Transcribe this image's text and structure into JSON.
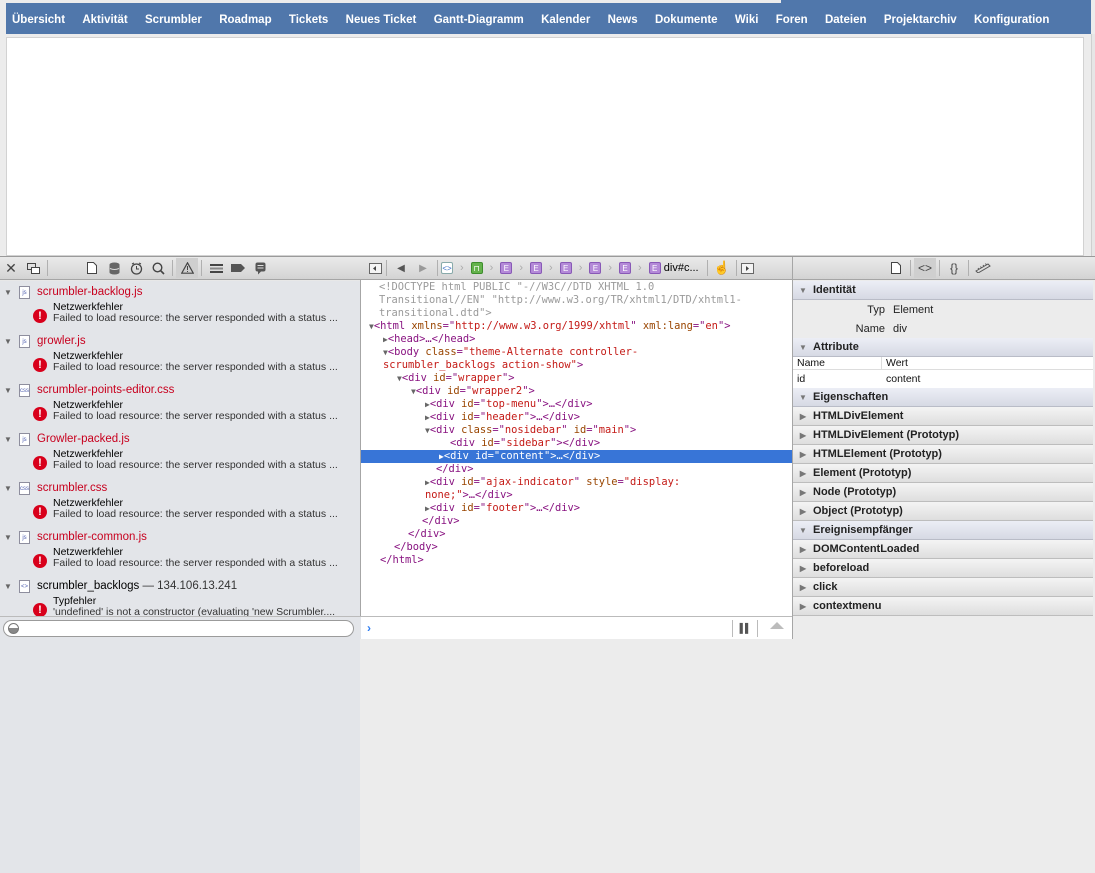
{
  "page": {
    "menu": [
      "Übersicht",
      "Aktivität",
      "Scrumbler",
      "Roadmap",
      "Tickets",
      "Neues Ticket",
      "Gantt-Diagramm",
      "Kalender",
      "News",
      "Dokumente",
      "Wiki",
      "Foren",
      "Dateien",
      "Projektarchiv",
      "Konfiguration"
    ],
    "brand_color": "#5077ab"
  },
  "console": {
    "toolbar_icons": [
      "close-icon",
      "undock-icon",
      "resources-icon",
      "storage-icon",
      "timeline-icon",
      "search-icon",
      "issues-icon",
      "log-icon",
      "breakpoints-icon",
      "console-icon"
    ],
    "groups": [
      {
        "file": "scrumbler-backlog.js",
        "type": "js",
        "title": "Netzwerkfehler",
        "message": "Failed to load resource: the server responded with a status ..."
      },
      {
        "file": "growler.js",
        "type": "js",
        "title": "Netzwerkfehler",
        "message": "Failed to load resource: the server responded with a status ..."
      },
      {
        "file": "scrumbler-points-editor.css",
        "type": "css",
        "title": "Netzwerkfehler",
        "message": "Failed to load resource: the server responded with a status ..."
      },
      {
        "file": "Growler-packed.js",
        "type": "js",
        "title": "Netzwerkfehler",
        "message": "Failed to load resource: the server responded with a status ..."
      },
      {
        "file": "scrumbler.css",
        "type": "css",
        "title": "Netzwerkfehler",
        "message": "Failed to load resource: the server responded with a status ..."
      },
      {
        "file": "scrumbler-common.js",
        "type": "js",
        "title": "Netzwerkfehler",
        "message": "Failed to load resource: the server responded with a status ..."
      },
      {
        "file": "scrumbler_backlogs",
        "type": "html",
        "host": " — 134.106.13.241",
        "title": "Typfehler",
        "message": "'undefined' is not a constructor (evaluating 'new Scrumbler...."
      }
    ],
    "filter_value": ""
  },
  "dom": {
    "breadcrumb_last": "div#c...",
    "tree": {
      "doctype1": "<!DOCTYPE html PUBLIC \"-//W3C//DTD XHTML 1.0",
      "doctype2": "Transitional//EN\" \"http://www.w3.org/TR/xhtml1/DTD/xhtml1-",
      "doctype3": "transitional.dtd\">",
      "html_xmlns": "http://www.w3.org/1999/xhtml",
      "html_lang": "en",
      "body_class1": "\"theme-Alternate controller-",
      "body_class2": "scrumbler_backlogs action-show\"",
      "ids": {
        "wrapper": "wrapper",
        "wrapper2": "wrapper2",
        "top_menu": "top-menu",
        "header": "header",
        "main_class": "nosidebar",
        "main": "main",
        "sidebar": "sidebar",
        "content": "content",
        "ajax": "ajax-indicator",
        "ajax_style1": "\"display:",
        "ajax_style2": "none;\"",
        "footer": "footer"
      }
    },
    "console_prompt": ""
  },
  "sidebar": {
    "sections": {
      "identity": "Identität",
      "attributes": "Attribute",
      "properties": "Eigenschaften",
      "listeners": "Ereignisempfänger"
    },
    "identity": {
      "type_label": "Typ",
      "type_value": "Element",
      "name_label": "Name",
      "name_value": "div"
    },
    "attr_cols": {
      "name": "Name",
      "value": "Wert"
    },
    "attrs": [
      {
        "name": "id",
        "value": "content"
      }
    ],
    "properties": [
      "HTMLDivElement",
      "HTMLDivElement (Prototyp)",
      "HTMLElement (Prototyp)",
      "Element (Prototyp)",
      "Node (Prototyp)",
      "Object (Prototyp)"
    ],
    "listeners": [
      "DOMContentLoaded",
      "beforeload",
      "click",
      "contextmenu"
    ]
  }
}
